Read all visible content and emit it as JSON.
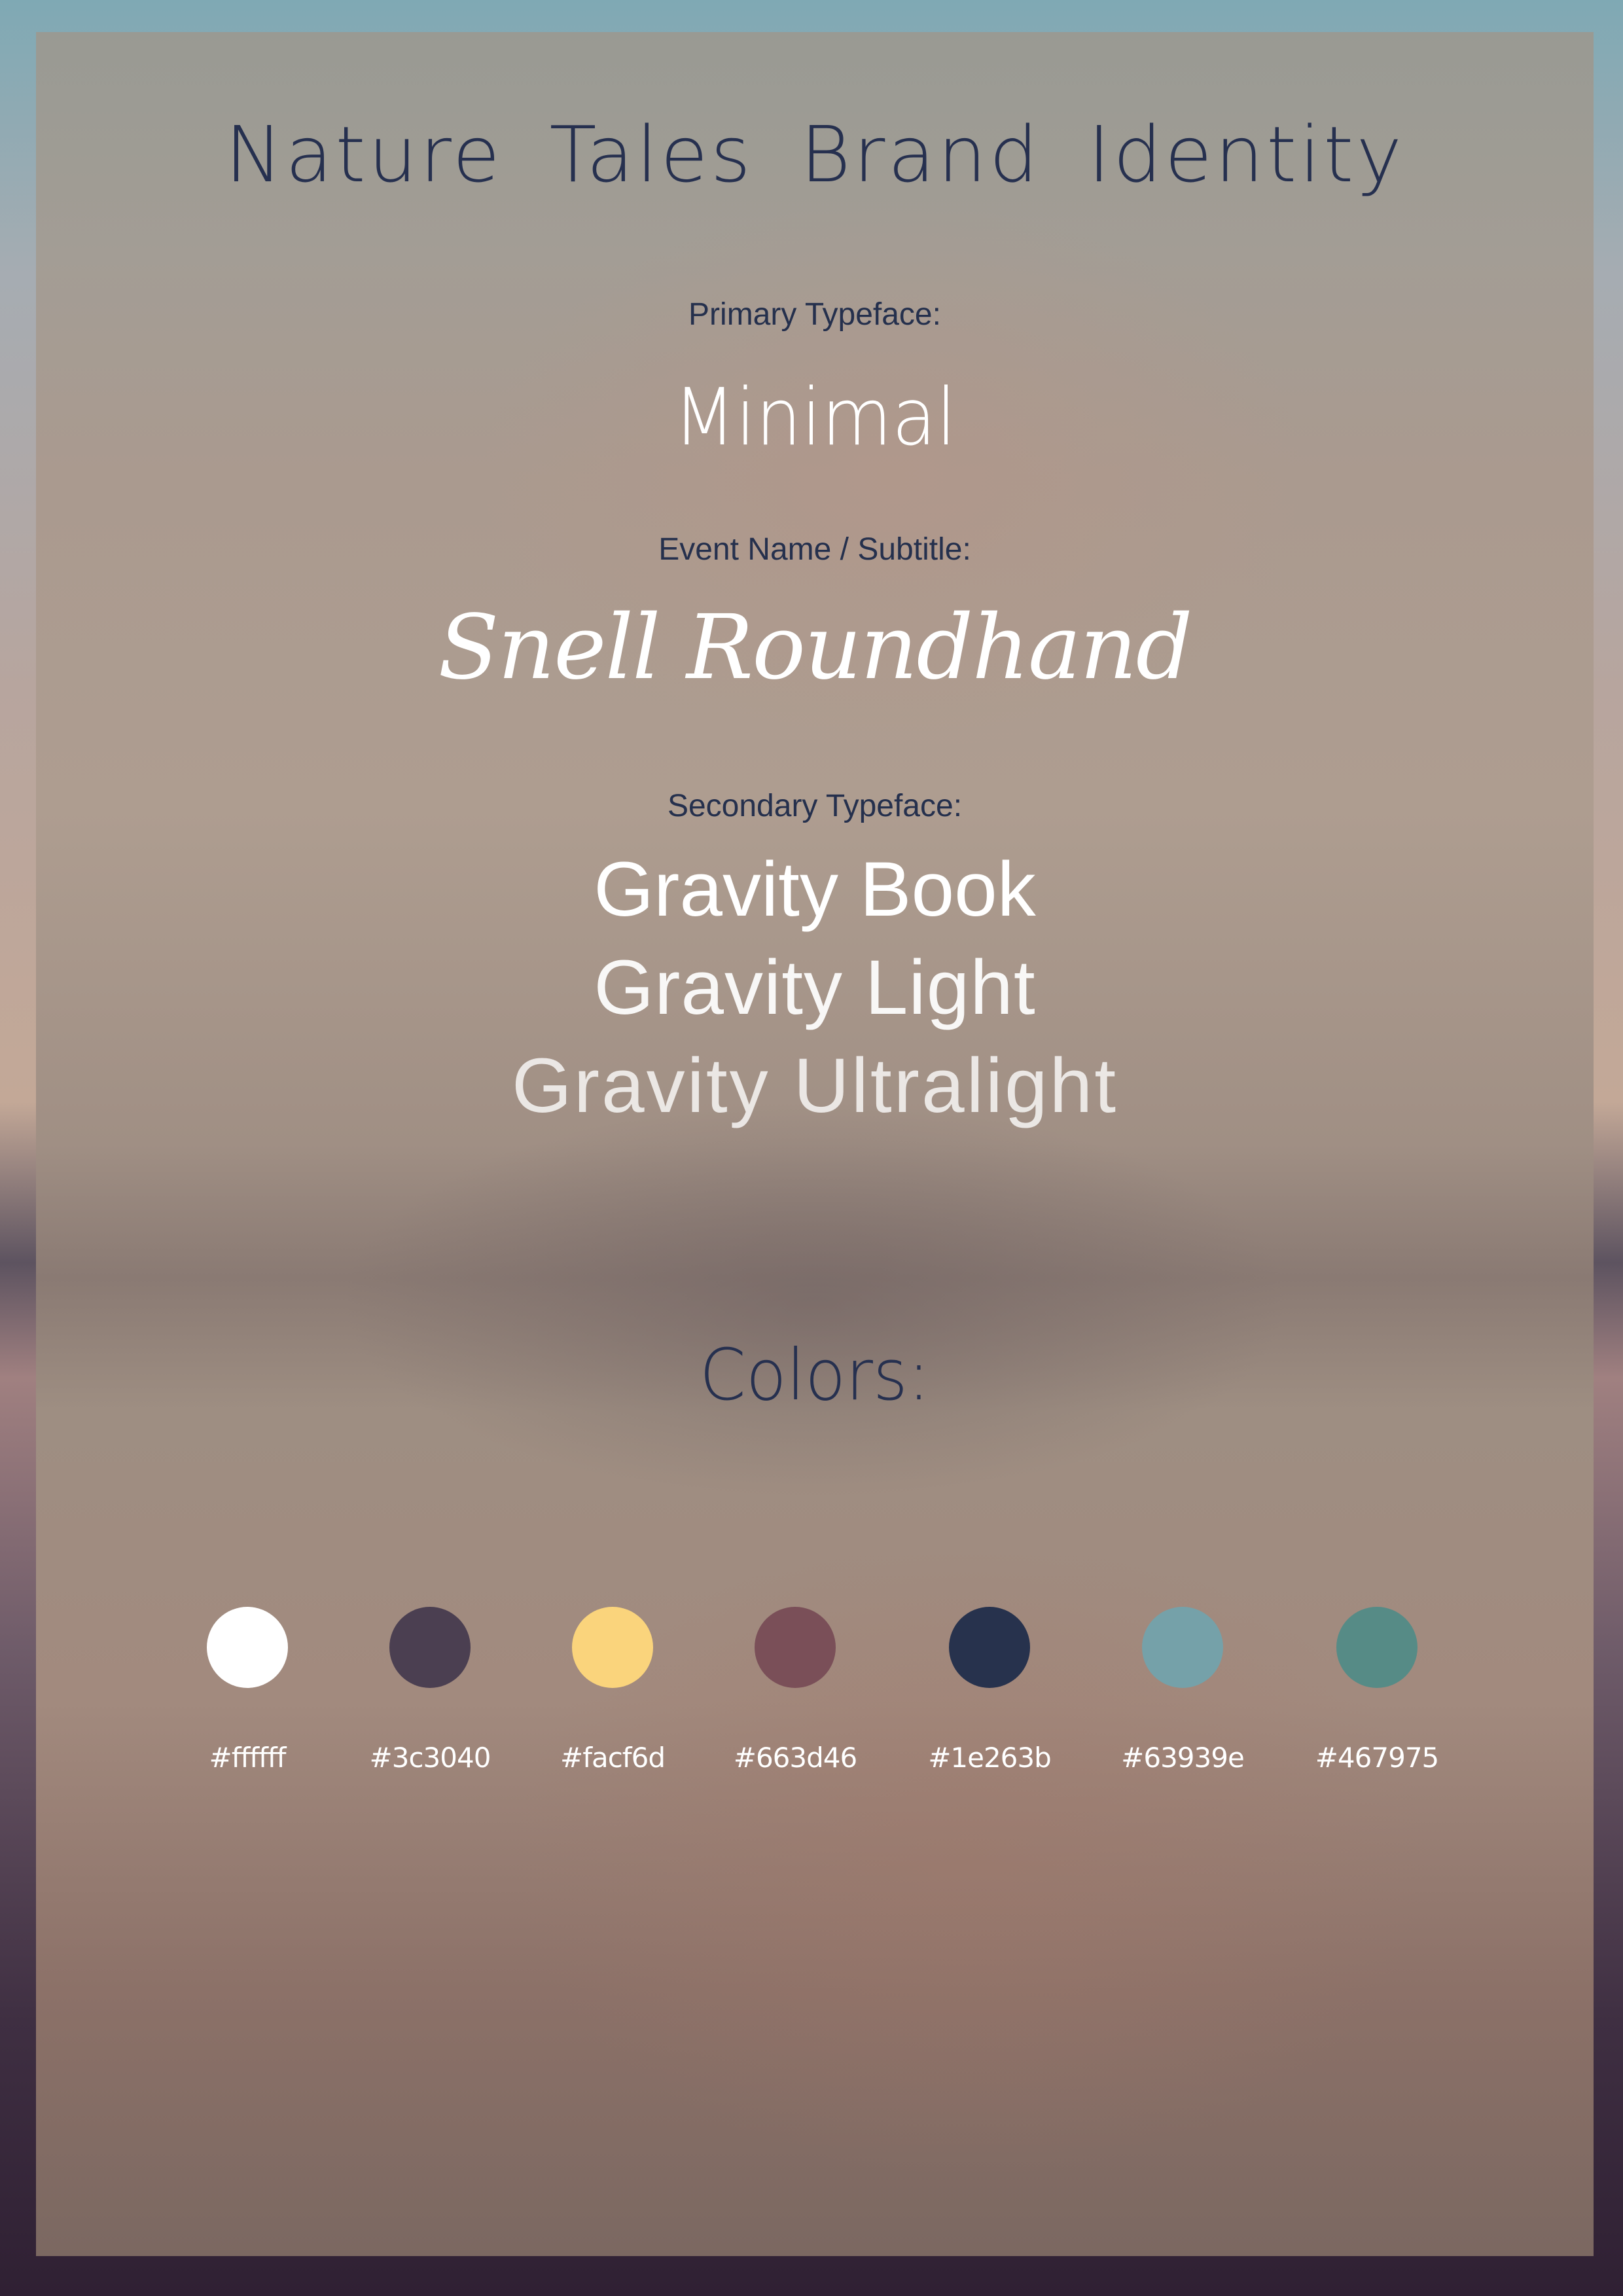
{
  "title": "Nature Tales Brand Identity",
  "typefaces": {
    "primary_label": "Primary Typeface:",
    "primary_sample": "Minimal",
    "event_label": "Event Name / Subtitle:",
    "event_sample": "Snell Roundhand",
    "secondary_label": "Secondary Typeface:",
    "secondary_samples": [
      "Gravity Book",
      "Gravity Light",
      "Gravity Ultralight"
    ]
  },
  "colors": {
    "heading": "Colors:",
    "swatches": [
      {
        "label": "#ffffff",
        "hex": "#ffffff"
      },
      {
        "label": "#3c3040",
        "hex": "#4b3f51"
      },
      {
        "label": "#facf6d",
        "hex": "#fad47c"
      },
      {
        "label": "#663d46",
        "hex": "#7a4f58"
      },
      {
        "label": "#1e263b",
        "hex": "#27324d"
      },
      {
        "label": "#63939e",
        "hex": "#75a1a9"
      },
      {
        "label": "#467975",
        "hex": "#568b86"
      }
    ]
  }
}
